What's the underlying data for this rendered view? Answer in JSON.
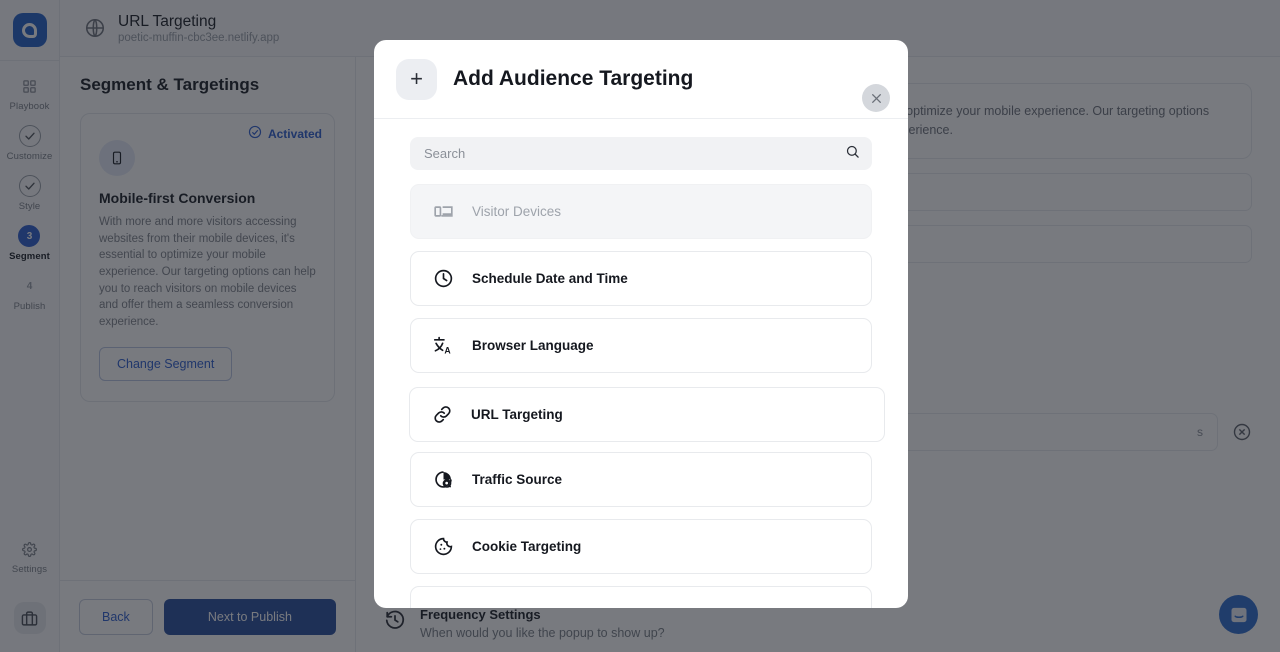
{
  "rail": {
    "logo_icon": "popupsmart-logo-icon",
    "steps": [
      {
        "glyph": "grid-icon",
        "label": "Playbook",
        "state": "plain"
      },
      {
        "glyph": "check-icon",
        "label": "Customize",
        "state": "done"
      },
      {
        "glyph": "check-icon",
        "label": "Style",
        "state": "done"
      },
      {
        "glyph": "3",
        "label": "Segment",
        "state": "active"
      },
      {
        "glyph": "4",
        "label": "Publish",
        "state": "upcoming"
      }
    ],
    "settings_label": "Settings",
    "settings_icon": "gear-icon",
    "briefcase_icon": "briefcase-icon"
  },
  "topbar": {
    "globe_icon": "globe-icon",
    "title": "URL Targeting",
    "subtitle": "poetic-muffin-cbc3ee.netlify.app"
  },
  "left_panel": {
    "title": "Segment & Targetings",
    "card": {
      "status_label": "Activated",
      "status_icon": "check-circle-icon",
      "segment_icon": "mobile-phone-icon",
      "name": "Mobile-first Conversion",
      "description": "With more and more visitors accessing websites from their mobile devices, it's essential to optimize your mobile experience. Our targeting options can help you to reach visitors on mobile devices and offer them a seamless conversion experience.",
      "change_button": "Change Segment"
    },
    "footer": {
      "back_label": "Back",
      "next_label": "Next to Publish"
    }
  },
  "right_panel": {
    "description": "With more and more visitors accessing websites from their mobile devices, it's essential to optimize your mobile experience. Our targeting options can help you to reach visitors on mobile devices and offer them a seamless conversion experience.",
    "seconds_suffix": "s",
    "remove_icon": "remove-circle-icon",
    "frequency": {
      "icon": "history-clock-icon",
      "title": "Frequency Settings",
      "subtitle": "When would you like the popup to show up?"
    },
    "intercom_icon": "chat-bubble-icon"
  },
  "modal": {
    "plus_icon": "plus-icon",
    "title": "Add Audience Targeting",
    "close_icon": "close-icon",
    "search": {
      "placeholder": "Search",
      "value": "",
      "icon": "search-icon"
    },
    "options": [
      {
        "label": "Visitor Devices",
        "icon": "devices-icon",
        "disabled": true
      },
      {
        "label": "Schedule Date and Time",
        "icon": "clock-icon",
        "disabled": false
      },
      {
        "label": "Browser Language",
        "icon": "translate-icon",
        "disabled": false
      },
      {
        "label": "Traffic Source",
        "icon": "traffic-source-icon",
        "disabled": false
      },
      {
        "label": "Cookie Targeting",
        "icon": "cookie-icon",
        "disabled": false
      }
    ],
    "highlighted_option": {
      "label": "URL Targeting",
      "icon": "link-icon"
    }
  },
  "colors": {
    "accent": "#2f5fd0",
    "accent_dark": "#2a4f9e",
    "scrim": "rgba(22,26,34,0.58)",
    "text": "#15181f",
    "muted": "#8b9098"
  }
}
